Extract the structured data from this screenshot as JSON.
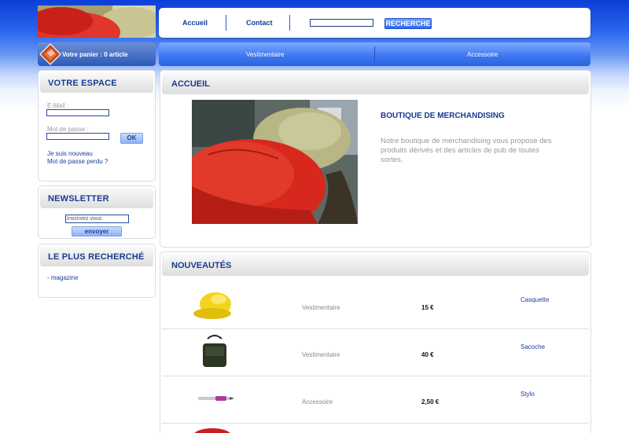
{
  "header": {
    "nav_links": [
      "Accueil",
      "Contact"
    ],
    "search": {
      "value": "",
      "button_label": "RECHERCHE"
    },
    "cart_label": "Votre panier : 0 article",
    "categories": [
      "Vestimentaire",
      "Accessoire"
    ]
  },
  "sidebar": {
    "account": {
      "title": "VOTRE ESPACE",
      "email_label": "E-Mail :",
      "password_label": "Mot de passe :",
      "ok_label": "OK",
      "links": [
        "Je suis nouveau",
        "Mot de passe perdu ?"
      ]
    },
    "newsletter": {
      "title": "NEWSLETTER",
      "input_value": "Inscrivez vous",
      "button_label": "envoyer"
    },
    "popular": {
      "title": "LE PLUS RECHERCHÉ",
      "items": [
        "- magazine"
      ]
    }
  },
  "main": {
    "home": {
      "title": "ACCUEIL",
      "shop_title": "BOUTIQUE DE MERCHANDISING",
      "description": "Notre boutique de merchandising vous propose des produits dérivés et des articles de pub de toutes sortes."
    },
    "news": {
      "title": "NOUVEAUTÉS",
      "products": [
        {
          "category": "Vestimentaire",
          "price": "15 €",
          "name": "Casquette",
          "icon": "yellow-cap-image"
        },
        {
          "category": "Vestimentaire",
          "price": "40 €",
          "name": "Sacoche",
          "icon": "bag-image"
        },
        {
          "category": "Accessoire",
          "price": "2,50 €",
          "name": "Stylo",
          "icon": "pen-image"
        }
      ]
    }
  },
  "colors": {
    "brand_blue": "#1a3a90",
    "bar_blue": "#3a76f0",
    "accent_red": "#d8281e"
  }
}
